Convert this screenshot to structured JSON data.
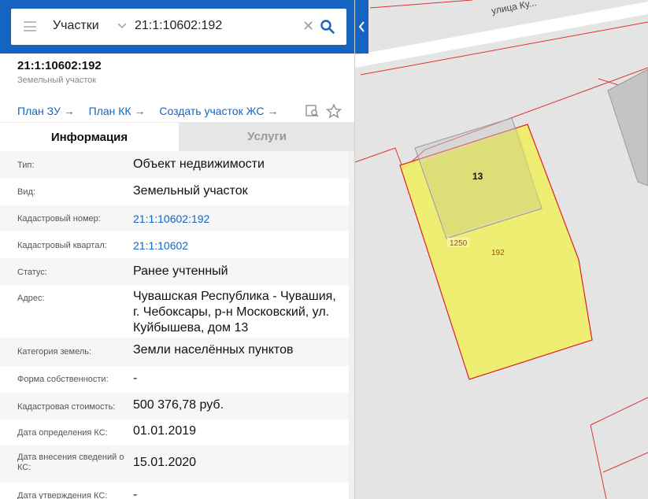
{
  "search": {
    "category": "Участки",
    "query": "21:1:10602:192"
  },
  "object": {
    "number": "21:1:10602:192",
    "type_subtitle": "Земельный участок"
  },
  "links": [
    "План ЗУ →",
    "План КК →",
    "Создать участок ЖС →"
  ],
  "tabs": {
    "info": "Информация",
    "services": "Услуги"
  },
  "rows": [
    {
      "label": "Тип:",
      "value": "Объект недвижимости"
    },
    {
      "label": "Вид:",
      "value": "Земельный участок"
    },
    {
      "label": "Кадастровый номер:",
      "value": "21:1:10602:192"
    },
    {
      "label": "Кадастровый квартал:",
      "value": "21:1:10602"
    },
    {
      "label": "Статус:",
      "value": "Ранее учтенный"
    },
    {
      "label": "Адрес:",
      "value": "Чувашская Республика - Чувашия, г. Чебоксары, р-н Московский, ул. Куйбышева, дом 13"
    },
    {
      "label": "Категория земель:",
      "value": "Земли населённых пунктов"
    },
    {
      "label": "Форма собственности:",
      "value": "-"
    },
    {
      "label": "Кадастровая стоимость:",
      "value": "500 376,78 руб."
    },
    {
      "label": "Дата определения КС:",
      "value": "01.01.2019"
    },
    {
      "label": "Дата внесения сведений о КС:",
      "value": "15.01.2020"
    },
    {
      "label": "Дата утверждения КС:",
      "value": "-"
    }
  ],
  "map": {
    "street_label": "улица Ку...",
    "building_number": "13",
    "parcel_labels": [
      "1250",
      "192"
    ]
  },
  "colors": {
    "brand": "#1565c0",
    "parcel_fill": "#eeee66",
    "parcel_border": "#e02020"
  }
}
